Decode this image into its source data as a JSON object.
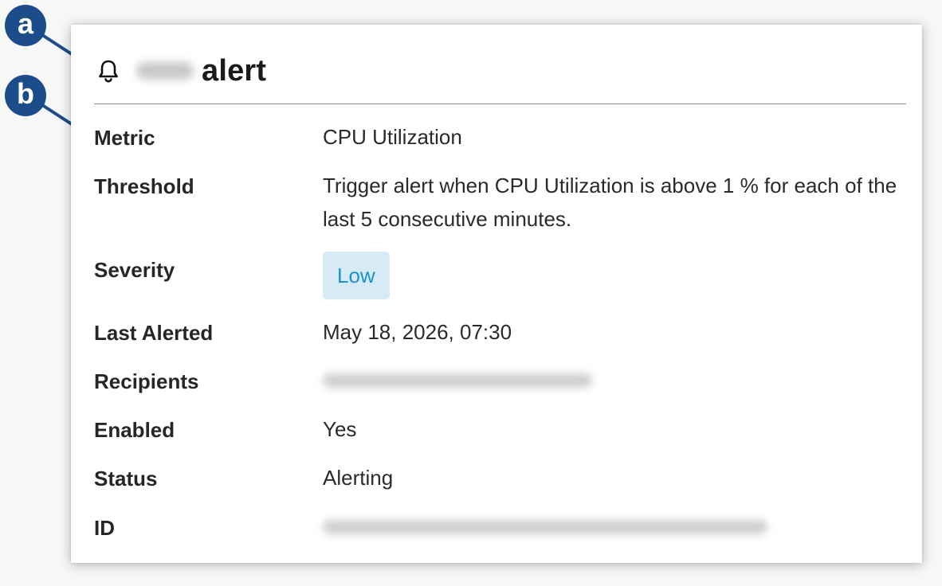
{
  "callouts": {
    "a": "a",
    "b": "b"
  },
  "header": {
    "title": "alert",
    "icon": "bell-icon"
  },
  "fields": {
    "metric": {
      "label": "Metric",
      "value": "CPU Utilization"
    },
    "threshold": {
      "label": "Threshold",
      "value": "Trigger alert when CPU Utilization is above 1 % for each of the last 5 consecutive minutes."
    },
    "severity": {
      "label": "Severity",
      "value": "Low"
    },
    "last_alerted": {
      "label": "Last Alerted",
      "value": "May 18, 2026, 07:30"
    },
    "recipients": {
      "label": "Recipients"
    },
    "enabled": {
      "label": "Enabled",
      "value": "Yes"
    },
    "status": {
      "label": "Status",
      "value": "Alerting"
    },
    "id": {
      "label": "ID"
    }
  },
  "colors": {
    "callout": "#1c4d8a",
    "severity_badge_bg": "#d6ebf6",
    "severity_badge_text": "#1b93d0"
  }
}
